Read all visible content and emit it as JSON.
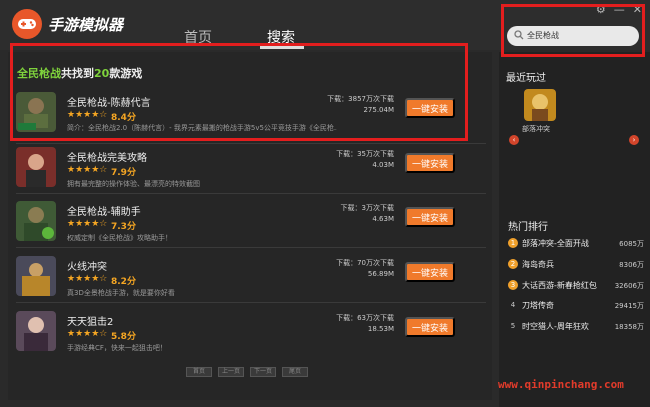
{
  "app": {
    "title": "手游模拟器"
  },
  "nav": {
    "home": "首页",
    "search": "搜索"
  },
  "search": {
    "query": "全民枪战"
  },
  "results": {
    "header_prefix": "全民枪战",
    "header_mid": "共找到",
    "header_count": "20",
    "header_suffix": "款游戏",
    "install_label": "一键安装",
    "items": [
      {
        "name": "全民枪战-陈赫代言",
        "stars": "★★★★☆",
        "rating": "8.4分",
        "desc": "简介：全民枪战2.0（陈赫代言）- 我界元素最搬的枪战手游5v5公平竞技手游《全民枪...",
        "downloads": "下载：3857万次下载",
        "size": "275.04M"
      },
      {
        "name": "全民枪战完美攻略",
        "stars": "★★★★☆",
        "rating": "7.9分",
        "desc": "拥有最完整的操作体验、最漂亮的特效截图",
        "downloads": "下载：35万次下载",
        "size": "4.03M"
      },
      {
        "name": "全民枪战-辅助手",
        "stars": "★★★★☆",
        "rating": "7.3分",
        "desc": "权威定制《全民枪战》攻略助手！",
        "downloads": "下载：3万次下载",
        "size": "4.63M"
      },
      {
        "name": "火线冲突",
        "stars": "★★★★☆",
        "rating": "8.2分",
        "desc": "真3D全景枪战手游，就是要你好看",
        "downloads": "下载：70万次下载",
        "size": "56.89M"
      },
      {
        "name": "天天狙击2",
        "stars": "★★★★☆",
        "rating": "5.8分",
        "desc": "手游经典CF，快来一起狙击吧！",
        "downloads": "下载：63万次下载",
        "size": "18.53M"
      }
    ]
  },
  "pagination": [
    "首页",
    "上一页",
    "下一页",
    "尾页"
  ],
  "sidebar": {
    "recent_title": "最近玩过",
    "recent_game": "部落冲突",
    "rank_title": "热门排行",
    "ranks": [
      {
        "num": "1",
        "name": "部落冲突-全面开战",
        "count": "6085万"
      },
      {
        "num": "2",
        "name": "海岛奇兵",
        "count": "8306万"
      },
      {
        "num": "3",
        "name": "大话西游-新春抢红包",
        "count": "32606万"
      },
      {
        "num": "4",
        "name": "刀塔传奇",
        "count": "29415万"
      },
      {
        "num": "5",
        "name": "时空猎人-周年狂欢",
        "count": "18358万"
      }
    ]
  },
  "watermark": "www.qinpinchang.com"
}
